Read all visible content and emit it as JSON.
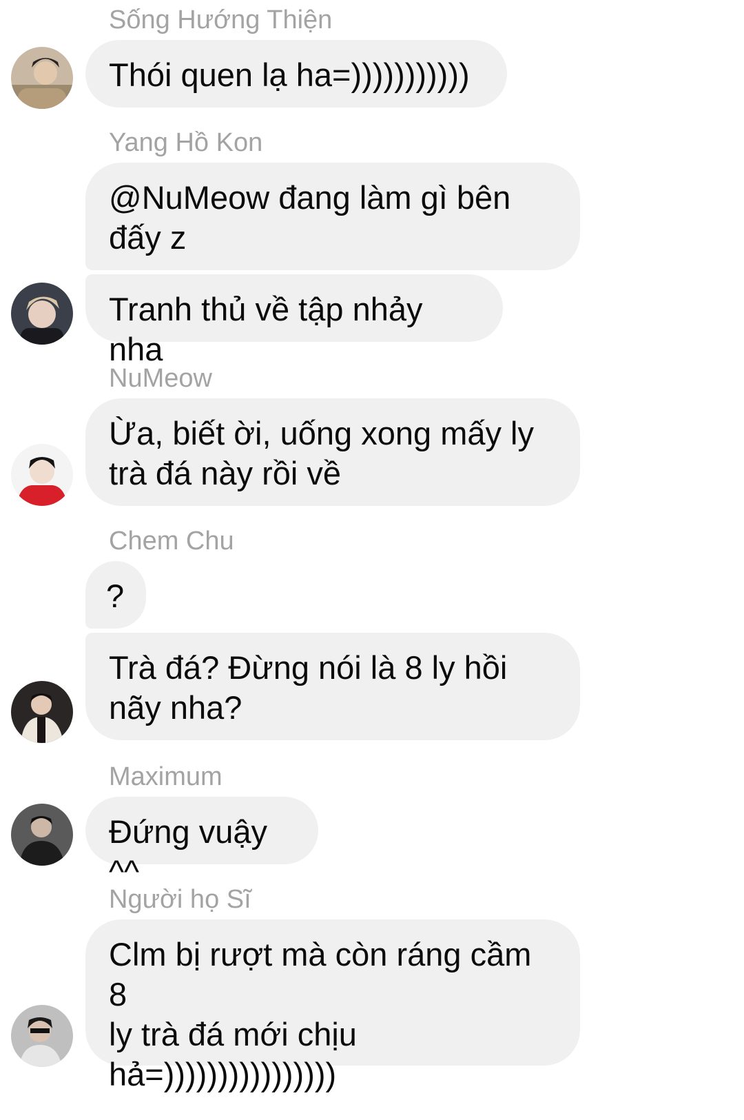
{
  "messages": [
    {
      "sender": "Sống Hướng Thiện",
      "bubbles": [
        "Thói quen lạ ha=)))))))))))"
      ]
    },
    {
      "sender": "Yang Hồ Kon",
      "bubbles": [
        "@NuMeow đang làm gì bên\nđấy z",
        "Tranh thủ về tập nhảy nha"
      ]
    },
    {
      "sender": "NuMeow",
      "bubbles": [
        "Ừa, biết ời, uống xong mấy ly\ntrà đá này rồi về"
      ]
    },
    {
      "sender": "Chem Chu",
      "bubbles": [
        "?",
        "Trà đá? Đừng nói là 8 ly hồi\nnãy nha?"
      ]
    },
    {
      "sender": "Maximum",
      "bubbles": [
        "Đứng vuậy ^^"
      ]
    },
    {
      "sender": "Người họ Sĩ",
      "bubbles": [
        "Clm bị rượt mà còn ráng cầm 8\nly trà đá mới chịu\nhả=))))))))))))))))"
      ]
    }
  ],
  "colors": {
    "bubble_bg": "#f0f0f0",
    "sender_text": "#a3a3a3",
    "message_text": "#0b0b0b"
  }
}
